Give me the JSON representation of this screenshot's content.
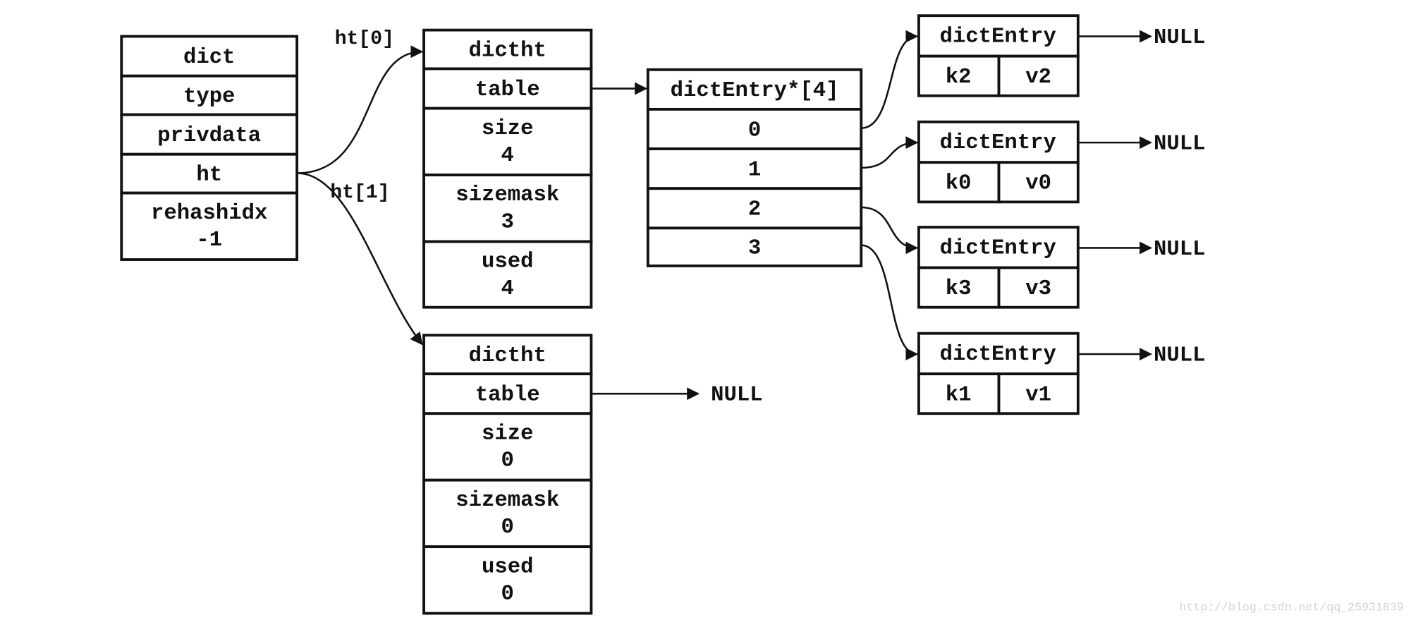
{
  "dict": {
    "rows": [
      [
        "dict"
      ],
      [
        "type"
      ],
      [
        "privdata"
      ],
      [
        "ht"
      ],
      [
        "rehashidx",
        "-1"
      ]
    ]
  },
  "labels": {
    "ht0": "ht[0]",
    "ht1": "ht[1]"
  },
  "ht0": {
    "rows": [
      [
        "dictht"
      ],
      [
        "table"
      ],
      [
        "size",
        "4"
      ],
      [
        "sizemask",
        "3"
      ],
      [
        "used",
        "4"
      ]
    ]
  },
  "ht1": {
    "rows": [
      [
        "dictht"
      ],
      [
        "table"
      ],
      [
        "size",
        "0"
      ],
      [
        "sizemask",
        "0"
      ],
      [
        "used",
        "0"
      ]
    ],
    "table_target": "NULL"
  },
  "table_array": {
    "rows": [
      [
        "dictEntry*[4]"
      ],
      [
        "0"
      ],
      [
        "1"
      ],
      [
        "2"
      ],
      [
        "3"
      ]
    ]
  },
  "entries": [
    {
      "title": "dictEntry",
      "key": "k2",
      "value": "v2",
      "next": "NULL",
      "from_index": "0"
    },
    {
      "title": "dictEntry",
      "key": "k0",
      "value": "v0",
      "next": "NULL",
      "from_index": "1"
    },
    {
      "title": "dictEntry",
      "key": "k3",
      "value": "v3",
      "next": "NULL",
      "from_index": "2"
    },
    {
      "title": "dictEntry",
      "key": "k1",
      "value": "v1",
      "next": "NULL",
      "from_index": "3"
    }
  ],
  "watermark": "http://blog.csdn.net/qq_25931839"
}
